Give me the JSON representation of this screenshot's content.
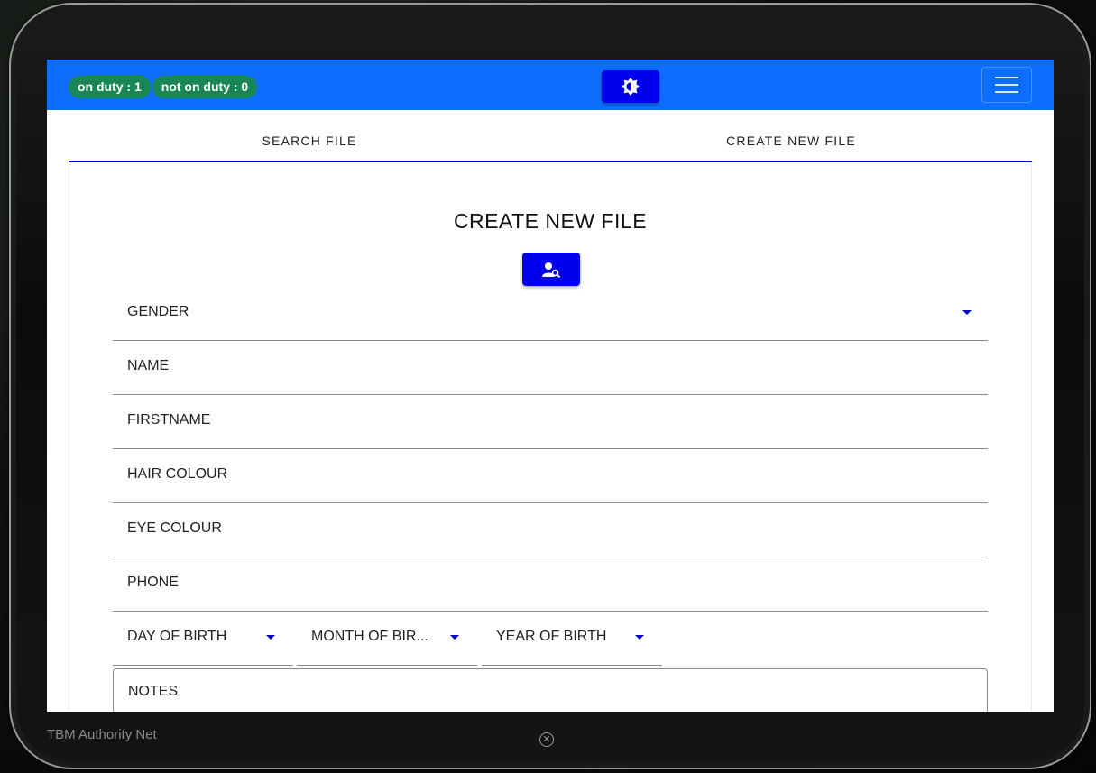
{
  "header": {
    "badges": [
      "on duty : 1",
      "not on duty : 0"
    ],
    "theme_icon": "brightness-icon",
    "menu_icon": "hamburger-icon"
  },
  "tabs": [
    "SEARCH FILE",
    "CREATE NEW FILE"
  ],
  "form": {
    "title": "CREATE NEW FILE",
    "search_icon": "user-search-icon",
    "fields": {
      "gender": "GENDER",
      "name": "NAME",
      "firstname": "FIRSTNAME",
      "hair": "HAIR COLOUR",
      "eye": "EYE COLOUR",
      "phone": "PHONE"
    },
    "dob": {
      "day": "DAY OF BIRTH",
      "month": "MONTH OF BIR...",
      "year": "YEAR OF BIRTH"
    },
    "notes": "NOTES"
  },
  "footer": {
    "brand": "TBM Authority Net",
    "close_icon": "close-circle-icon"
  },
  "colors": {
    "topbar": "#0d6efd",
    "badge": "#198754",
    "button": "#0000ee",
    "accent": "#0000cc"
  }
}
